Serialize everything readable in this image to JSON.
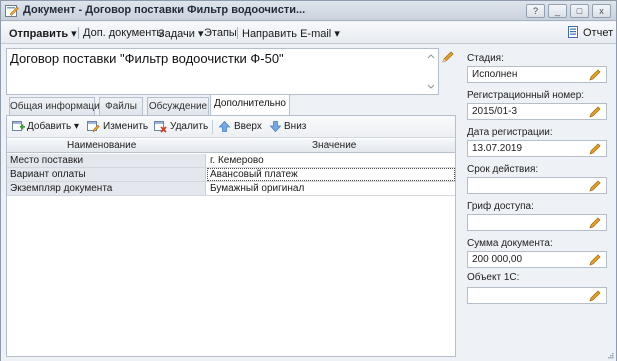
{
  "window": {
    "title": "Документ - Договор поставки Фильтр водоочисти...",
    "buttons": {
      "help": "?",
      "minimize": "_",
      "maximize": "□",
      "close": "x"
    }
  },
  "toolbar": {
    "send": "Отправить",
    "extra_docs": "Доп. документы",
    "tasks": "Задачи",
    "stages": "Этапы",
    "email": "Направить E-mail",
    "report": "Отчет"
  },
  "document": {
    "title": "Договор поставки \"Фильтр водоочистки Ф-50\""
  },
  "tabs": [
    {
      "label": "Общая информация",
      "active": false
    },
    {
      "label": "Файлы",
      "active": false
    },
    {
      "label": "Обсуждение",
      "active": false
    },
    {
      "label": "Дополнительно",
      "active": true
    }
  ],
  "panel_toolbar": {
    "add": "Добавить",
    "edit": "Изменить",
    "delete": "Удалить",
    "up": "Вверх",
    "down": "Вниз"
  },
  "grid": {
    "columns": [
      "Наименование",
      "Значение"
    ],
    "rows": [
      {
        "name": "Место поставки",
        "value": "г. Кемерово"
      },
      {
        "name": "Вариант оплаты",
        "value": "Авансовый платеж"
      },
      {
        "name": "Экземпляр документа",
        "value": "Бумажный оригинал"
      }
    ]
  },
  "fields": {
    "stage": {
      "label": "Стадия:",
      "value": "Исполнен"
    },
    "reg_number": {
      "label": "Регистрационный номер:",
      "value": "2015/01-3"
    },
    "reg_date": {
      "label": "Дата регистрации:",
      "value": "13.07.2019"
    },
    "validity": {
      "label": "Срок действия:",
      "value": ""
    },
    "access": {
      "label": "Гриф доступа:",
      "value": ""
    },
    "amount": {
      "label": "Сумма документа:",
      "value": "200 000,00"
    },
    "object_1c": {
      "label": "Объект 1С:",
      "value": ""
    }
  },
  "colors": {
    "accent_orange": "#e8a020",
    "add_green": "#3c9a3a",
    "delete_red": "#d23a2a",
    "arrow_blue": "#3f7fd0"
  },
  "icons": {
    "app": "document-window-icon",
    "report": "report-icon",
    "edit": "pencil-icon",
    "add": "add-row-icon",
    "change": "edit-row-icon",
    "remove": "delete-row-icon",
    "up": "arrow-up-icon",
    "down": "arrow-down-icon"
  }
}
